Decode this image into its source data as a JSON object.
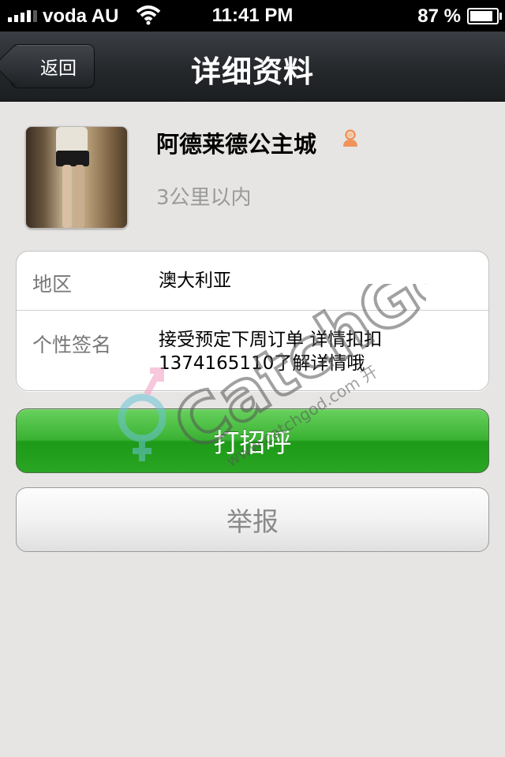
{
  "status_bar": {
    "carrier": "voda AU",
    "time": "11:41 PM",
    "battery_percent": "87 %",
    "battery_level": 0.87,
    "icons": [
      "signal-icon",
      "wifi-icon",
      "battery-icon"
    ]
  },
  "nav": {
    "back_label": "返回",
    "title": "详细资料"
  },
  "profile": {
    "nickname": "阿德莱德公主城",
    "distance": "3公里以内",
    "gender_icon": "female-user-icon",
    "gender_color": "#f0935a"
  },
  "info": {
    "region_label": "地区",
    "region_value": "澳大利亚",
    "signature_label": "个性签名",
    "signature_value": "接受预定下周订单 详情扣扣1374165110了解详情哦"
  },
  "actions": {
    "greet_label": "打招呼",
    "report_label": "举报"
  },
  "watermark": {
    "brand": "CatchGod",
    "url": "www.catchgod.com 开"
  },
  "colors": {
    "accent_green": "#2aa524",
    "navbar": "#25282b",
    "background": "#e6e5e3"
  }
}
